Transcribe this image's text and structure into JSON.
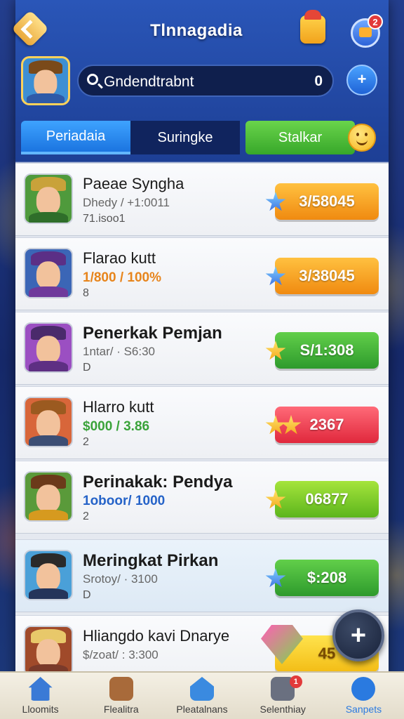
{
  "header": {
    "title": "Tlnnagadia",
    "notification_count": "2"
  },
  "search": {
    "text": "Gndendtrabnt",
    "count": "0"
  },
  "tabs": [
    {
      "label": "Periadaia"
    },
    {
      "label": "Suringke"
    },
    {
      "label": "Stalkar"
    }
  ],
  "rows": [
    {
      "name": "Paeae Syngha",
      "stat": "Dhedy / +1:0011",
      "sub": "71.isoo1",
      "button": "3/58045",
      "button_color": "orange",
      "icon": "blue-star-icon",
      "avatar_bg": "#4f9a3c",
      "avatar_hat": "#c9a23a",
      "avatar_shirt": "#2f6e2a"
    },
    {
      "name": "Flarao kutt",
      "stat": "1/800 / 100%",
      "sub": "8",
      "button": "3/38045",
      "button_color": "orange",
      "icon": "blue-star-icon",
      "avatar_bg": "#3b66b6",
      "avatar_hat": "#5b2f86",
      "avatar_shirt": "#6f3a9b"
    },
    {
      "name": "Penerkak Pemjan",
      "stat": "1ntar/ · S6:30",
      "sub": "D",
      "button": "S/1:308",
      "button_color": "green",
      "icon": "star-icon",
      "avatar_bg": "#9b4fc2",
      "avatar_hat": "#4a2a6b",
      "avatar_shirt": "#5e2f83"
    },
    {
      "name": "Hlarro kutt",
      "stat": "$000 / 3.86",
      "sub": "2",
      "button": "2367",
      "button_color": "red",
      "icon": "double-star-icon",
      "avatar_bg": "#d8663a",
      "avatar_hat": "#9b5a20",
      "avatar_shirt": "#3c4e74"
    },
    {
      "name": "Perinakak: Pendya",
      "stat": "1oboor/ 1000",
      "sub": "2",
      "button": "06877",
      "button_color": "lime",
      "icon": "star-icon",
      "avatar_bg": "#5a9a3a",
      "avatar_hat": "#6b3a1a",
      "avatar_shirt": "#d69a1f"
    },
    {
      "name": "Meringkat Pirkan",
      "stat": "Srotoy/ · 3100",
      "sub": "D",
      "button": "$:208",
      "button_color": "green",
      "icon": "blue-star-icon",
      "avatar_bg": "#4aa0d8",
      "avatar_hat": "#2a2a2a",
      "avatar_shirt": "#24345a"
    },
    {
      "name": "Hliangdo kavi Dnarye",
      "stat": "$/zoat/ : 3:300",
      "sub": "",
      "button": "45",
      "button_color": "yellow",
      "icon": "gem-icon",
      "avatar_bg": "#a04a2a",
      "avatar_hat": "#e8c86a",
      "avatar_shirt": "#7a3a2a"
    }
  ],
  "fab": {
    "symbol": "+"
  },
  "bottom_nav": [
    {
      "label": "Lloomits",
      "icon": "home-icon",
      "color": "#3a7ad6"
    },
    {
      "label": "Flealitra",
      "icon": "guild-icon",
      "color": "#a86a3a"
    },
    {
      "label": "Pleatalnans",
      "icon": "house-icon",
      "color": "#3a8ae0"
    },
    {
      "label": "Selenthiay",
      "icon": "shop-icon",
      "color": "#6a7080",
      "badge": "1"
    },
    {
      "label": "Sanpets",
      "icon": "profile-icon",
      "color": "#2a7ae0"
    }
  ]
}
